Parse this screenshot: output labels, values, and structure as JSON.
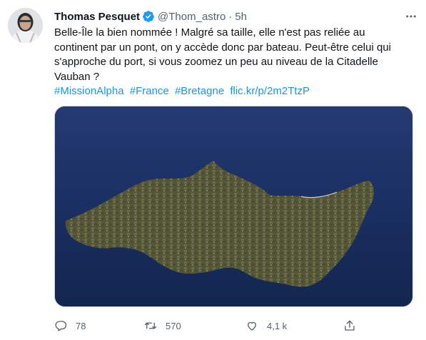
{
  "author": {
    "name": "Thomas Pesquet",
    "handle": "@Thom_astro",
    "separator": "·",
    "time": "5h"
  },
  "tweet": {
    "text": "Belle-Île la bien nommée ! Malgré sa taille, elle n'est pas reliée au\ncontinent par un pont, on y accède donc par bateau. Peut-être celui qui\ns'approche du port, si vous zoomez un peu au niveau de la Citadelle\nVauban ?",
    "tags": [
      "#MissionAlpha",
      "#France",
      "#Bretagne",
      "flic.kr/p/2m2TtzP"
    ]
  },
  "stats": {
    "replies": "78",
    "retweets": "570",
    "likes": "4,1 k"
  },
  "colors": {
    "link": "#1b95e0",
    "verified": "#1d9bf0",
    "muted": "#536471"
  },
  "icons": [
    "verified-badge-icon",
    "more-icon",
    "reply-icon",
    "retweet-icon",
    "like-icon",
    "share-icon"
  ]
}
